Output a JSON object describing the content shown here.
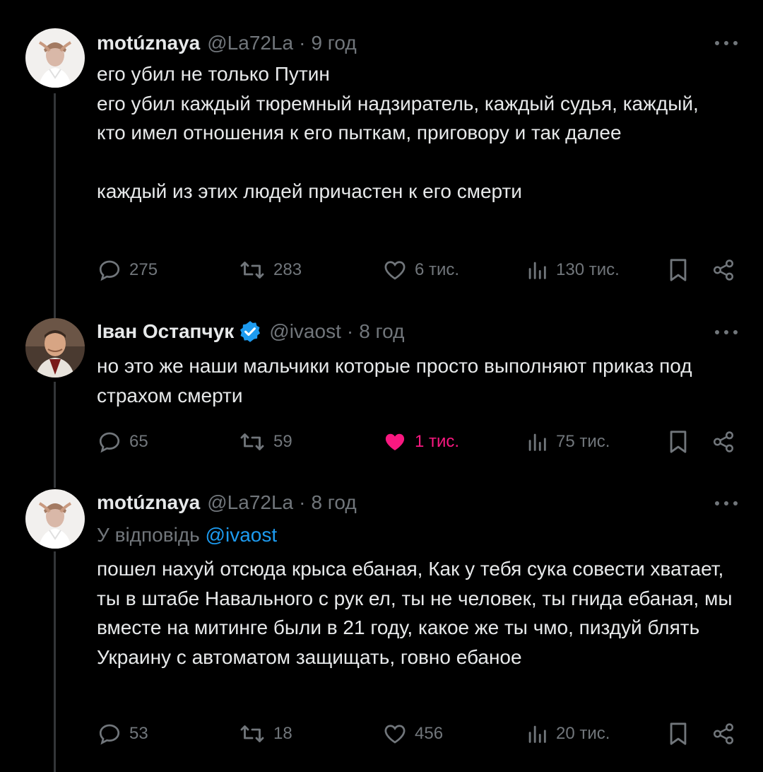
{
  "colors": {
    "background": "#000000",
    "text": "#e7e9ea",
    "muted": "#71767b",
    "link": "#1d9bf0",
    "like_active": "#f91880",
    "verified": "#1d9bf0"
  },
  "tweets": [
    {
      "name": "motúznaya",
      "handle": "@La72La",
      "separator": "·",
      "time": "9 год",
      "verified": false,
      "text": "его убил не только Путин\nего убил каждый тюремный надзиратель, каждый судья, каждый, кто имел отношения к его пыткам, приговору и так далее\n\nкаждый из этих людей причастен к его смерти",
      "replies": "275",
      "retweets": "283",
      "likes": "6 тис.",
      "views": "130 тис.",
      "liked": false,
      "icons": [
        "reply-icon",
        "retweet-icon",
        "heart-icon",
        "views-icon",
        "bookmark-icon",
        "share-icon",
        "more-icon"
      ]
    },
    {
      "name": "Іван Остапчук",
      "handle": "@ivaost",
      "separator": "·",
      "time": "8 год",
      "verified": true,
      "text": "но это же наши мальчики которые просто выполняют приказ под страхом смерти",
      "replies": "65",
      "retweets": "59",
      "likes": "1 тис.",
      "views": "75 тис.",
      "liked": true
    },
    {
      "name": "motúznaya",
      "handle": "@La72La",
      "separator": "·",
      "time": "8 год",
      "verified": false,
      "reply_prefix": "У відповідь",
      "reply_mention": "@ivaost",
      "text": "пошел нахуй отсюда крыса ебаная, Как у тебя сука совести хватает, ты в штабе Навального с рук ел, ты не человек, ты гнида ебаная, мы вместе на митинге были в 21 году, какое же ты чмо, пиздуй блять Украину с автоматом защищать, говно ебаное",
      "replies": "53",
      "retweets": "18",
      "likes": "456",
      "views": "20 тис.",
      "liked": false
    }
  ]
}
